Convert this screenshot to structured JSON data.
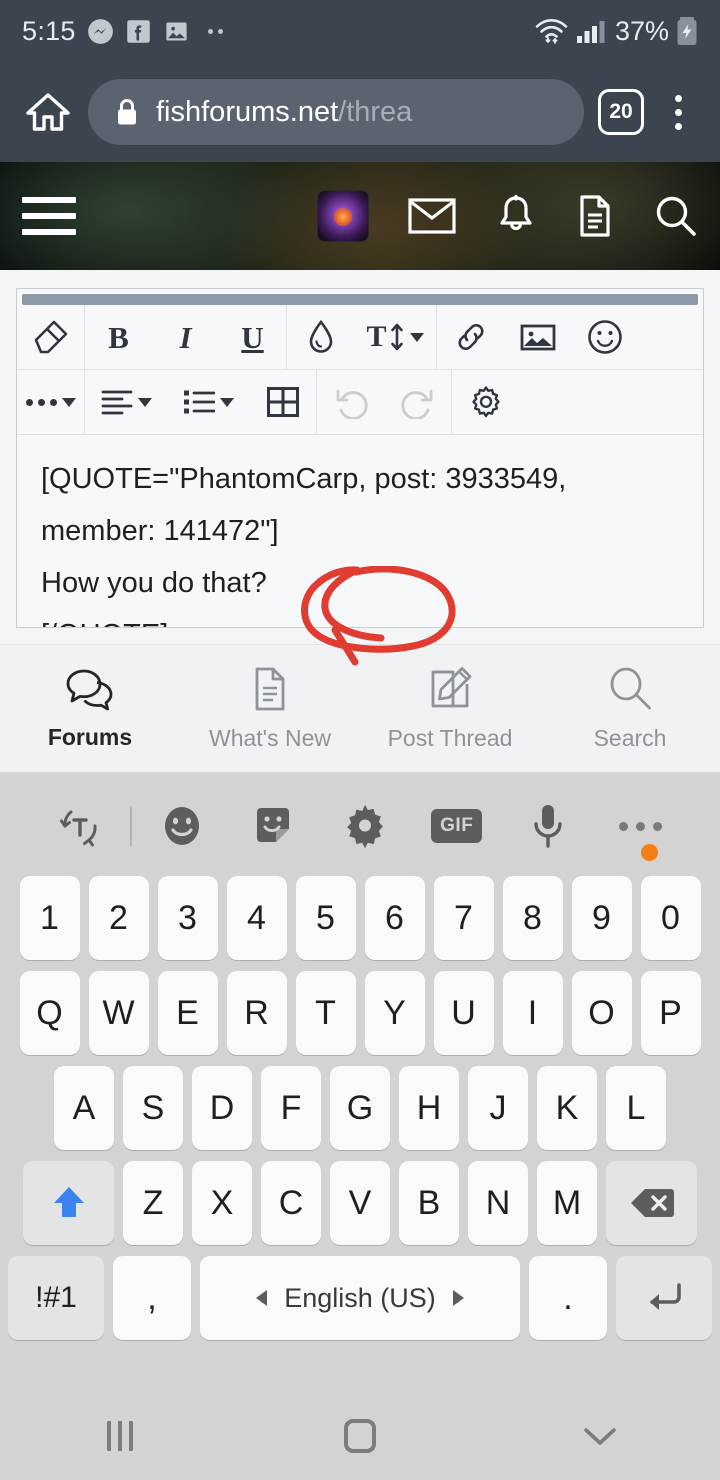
{
  "status_bar": {
    "time": "5:15",
    "battery_percent": "37%",
    "icons": [
      "messenger-icon",
      "facebook-icon",
      "photos-icon",
      "more-notifications-dots",
      "wifi-icon",
      "cellular-signal-icon",
      "battery-charging-icon"
    ]
  },
  "browser": {
    "home_icon": "home-icon",
    "lock_icon": "lock-icon",
    "url_domain": "fishforums.net",
    "url_path": "/threa",
    "tab_count": "20",
    "menu_icon": "kebab-menu-icon"
  },
  "forum_header": {
    "menu_icon": "hamburger-menu-icon",
    "avatar": "user-avatar",
    "icons": [
      "mail-icon",
      "bell-icon",
      "document-icon",
      "search-icon"
    ]
  },
  "editor": {
    "toolbar_row1": [
      {
        "name": "remove-formatting-button",
        "glyph": "eraser-icon"
      },
      {
        "name": "bold-button",
        "label": "B"
      },
      {
        "name": "italic-button",
        "label": "I"
      },
      {
        "name": "underline-button",
        "label": "U"
      },
      {
        "name": "text-color-button",
        "glyph": "droplet-icon"
      },
      {
        "name": "font-size-button",
        "label": "T",
        "glyph": "updown-arrow-icon",
        "has_caret": true
      },
      {
        "name": "insert-link-button",
        "glyph": "link-icon"
      },
      {
        "name": "insert-image-button",
        "glyph": "image-icon"
      },
      {
        "name": "insert-emoji-button",
        "glyph": "smiley-icon"
      }
    ],
    "toolbar_row2": [
      {
        "name": "more-options-button",
        "glyph": "three-dots-icon",
        "has_caret": true
      },
      {
        "name": "text-align-button",
        "glyph": "align-left-icon",
        "has_caret": true
      },
      {
        "name": "list-button",
        "glyph": "bullet-list-icon",
        "has_caret": true
      },
      {
        "name": "insert-table-button",
        "glyph": "table-icon"
      },
      {
        "name": "undo-button",
        "glyph": "undo-icon",
        "disabled": true
      },
      {
        "name": "redo-button",
        "glyph": "redo-icon",
        "disabled": true
      },
      {
        "name": "editor-settings-button",
        "glyph": "gear-icon"
      }
    ],
    "content_line1": "[QUOTE=\"PhantomCarp, post: 3933549,",
    "content_line2": "member: 141472\"]",
    "content_line3": "How you do that?",
    "content_line4": "[/QUOTE]"
  },
  "annotation": {
    "type": "hand-drawn-circle",
    "color": "#e03c31",
    "targets": [
      "text-color-button",
      "font-size-button"
    ]
  },
  "forum_nav": [
    {
      "label": "Forums",
      "icon": "chat-bubbles-icon",
      "active": true
    },
    {
      "label": "What's New",
      "icon": "document-icon",
      "active": false
    },
    {
      "label": "Post Thread",
      "icon": "pencil-square-icon",
      "active": false
    },
    {
      "label": "Search",
      "icon": "search-icon",
      "active": false
    }
  ],
  "keyboard": {
    "toolbar": [
      {
        "name": "text-rotate-icon"
      },
      {
        "name": "divider"
      },
      {
        "name": "emoji-icon"
      },
      {
        "name": "sticker-icon"
      },
      {
        "name": "gear-icon"
      },
      {
        "name": "gif-icon",
        "label": "GIF"
      },
      {
        "name": "microphone-icon"
      },
      {
        "name": "overflow-dots-icon",
        "badge": true
      }
    ],
    "row_numbers": [
      "1",
      "2",
      "3",
      "4",
      "5",
      "6",
      "7",
      "8",
      "9",
      "0"
    ],
    "row_top": [
      "Q",
      "W",
      "E",
      "R",
      "T",
      "Y",
      "U",
      "I",
      "O",
      "P"
    ],
    "row_home": [
      "A",
      "S",
      "D",
      "F",
      "G",
      "H",
      "J",
      "K",
      "L"
    ],
    "row_bottom": [
      "Z",
      "X",
      "C",
      "V",
      "B",
      "N",
      "M"
    ],
    "shift_key": "shift-icon",
    "backspace_key": "backspace-icon",
    "symbols_key": "!#1",
    "comma_key": ",",
    "space_key": "English (US)",
    "period_key": ".",
    "enter_key": "enter-icon",
    "accent_color": "#3b84f0"
  },
  "android_nav": {
    "recents": "recents-icon",
    "home": "home-icon",
    "hide_keyboard": "chevron-down-icon"
  }
}
